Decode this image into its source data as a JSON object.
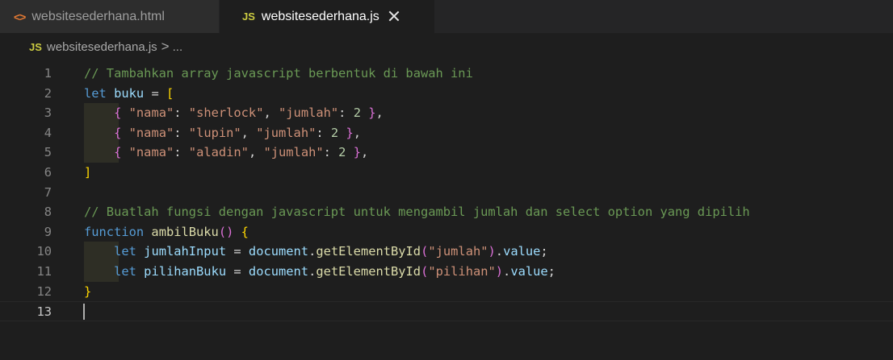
{
  "tabs": [
    {
      "label": "websitesederhana.html",
      "icon": "html-file-icon",
      "icon_glyph": "<>",
      "active": false
    },
    {
      "label": "websitesederhana.js",
      "icon": "js-file-icon",
      "icon_glyph": "JS",
      "active": true
    }
  ],
  "breadcrumb": {
    "icon_glyph": "JS",
    "file": "websitesederhana.js",
    "separator": ">",
    "rest": "..."
  },
  "editor": {
    "current_line": 13,
    "colors": {
      "background": "#1e1e1e",
      "comment": "#6a9955",
      "keyword": "#569cd6",
      "variable": "#9cdcfe",
      "string": "#ce9178",
      "number": "#b5cea8",
      "function": "#dcdcaa",
      "bracket_level1": "#ffd700",
      "bracket_level2": "#da70d6"
    },
    "lines": [
      {
        "n": "1",
        "indent": false,
        "tokens": [
          {
            "t": "// Tambahkan array javascript berbentuk di bawah ini",
            "c": "comment"
          }
        ]
      },
      {
        "n": "2",
        "indent": false,
        "tokens": [
          {
            "t": "let",
            "c": "kw"
          },
          {
            "t": " ",
            "c": "plain"
          },
          {
            "t": "buku",
            "c": "var"
          },
          {
            "t": " = ",
            "c": "plain"
          },
          {
            "t": "[",
            "c": "br1"
          }
        ]
      },
      {
        "n": "3",
        "indent": true,
        "tokens": [
          {
            "t": "    ",
            "c": "plain"
          },
          {
            "t": "{",
            "c": "br2"
          },
          {
            "t": " ",
            "c": "plain"
          },
          {
            "t": "\"nama\"",
            "c": "str"
          },
          {
            "t": ": ",
            "c": "plain"
          },
          {
            "t": "\"sherlock\"",
            "c": "str"
          },
          {
            "t": ", ",
            "c": "plain"
          },
          {
            "t": "\"jumlah\"",
            "c": "str"
          },
          {
            "t": ": ",
            "c": "plain"
          },
          {
            "t": "2",
            "c": "num"
          },
          {
            "t": " ",
            "c": "plain"
          },
          {
            "t": "}",
            "c": "br2"
          },
          {
            "t": ",",
            "c": "plain"
          }
        ]
      },
      {
        "n": "4",
        "indent": true,
        "tokens": [
          {
            "t": "    ",
            "c": "plain"
          },
          {
            "t": "{",
            "c": "br2"
          },
          {
            "t": " ",
            "c": "plain"
          },
          {
            "t": "\"nama\"",
            "c": "str"
          },
          {
            "t": ": ",
            "c": "plain"
          },
          {
            "t": "\"lupin\"",
            "c": "str"
          },
          {
            "t": ", ",
            "c": "plain"
          },
          {
            "t": "\"jumlah\"",
            "c": "str"
          },
          {
            "t": ": ",
            "c": "plain"
          },
          {
            "t": "2",
            "c": "num"
          },
          {
            "t": " ",
            "c": "plain"
          },
          {
            "t": "}",
            "c": "br2"
          },
          {
            "t": ",",
            "c": "plain"
          }
        ]
      },
      {
        "n": "5",
        "indent": true,
        "tokens": [
          {
            "t": "    ",
            "c": "plain"
          },
          {
            "t": "{",
            "c": "br2"
          },
          {
            "t": " ",
            "c": "plain"
          },
          {
            "t": "\"nama\"",
            "c": "str"
          },
          {
            "t": ": ",
            "c": "plain"
          },
          {
            "t": "\"aladin\"",
            "c": "str"
          },
          {
            "t": ", ",
            "c": "plain"
          },
          {
            "t": "\"jumlah\"",
            "c": "str"
          },
          {
            "t": ": ",
            "c": "plain"
          },
          {
            "t": "2",
            "c": "num"
          },
          {
            "t": " ",
            "c": "plain"
          },
          {
            "t": "}",
            "c": "br2"
          },
          {
            "t": ",",
            "c": "plain"
          }
        ]
      },
      {
        "n": "6",
        "indent": false,
        "tokens": [
          {
            "t": "]",
            "c": "br1"
          }
        ]
      },
      {
        "n": "7",
        "indent": false,
        "tokens": []
      },
      {
        "n": "8",
        "indent": false,
        "tokens": [
          {
            "t": "// Buatlah fungsi dengan javascript untuk mengambil jumlah dan select option yang dipilih",
            "c": "comment"
          }
        ]
      },
      {
        "n": "9",
        "indent": false,
        "tokens": [
          {
            "t": "function",
            "c": "kw"
          },
          {
            "t": " ",
            "c": "plain"
          },
          {
            "t": "ambilBuku",
            "c": "fn"
          },
          {
            "t": "()",
            "c": "br2"
          },
          {
            "t": " ",
            "c": "plain"
          },
          {
            "t": "{",
            "c": "br1"
          }
        ]
      },
      {
        "n": "10",
        "indent": true,
        "tokens": [
          {
            "t": "    ",
            "c": "plain"
          },
          {
            "t": "let",
            "c": "kw"
          },
          {
            "t": " ",
            "c": "plain"
          },
          {
            "t": "jumlahInput",
            "c": "var"
          },
          {
            "t": " = ",
            "c": "plain"
          },
          {
            "t": "document",
            "c": "var"
          },
          {
            "t": ".",
            "c": "plain"
          },
          {
            "t": "getElementById",
            "c": "fn"
          },
          {
            "t": "(",
            "c": "br2"
          },
          {
            "t": "\"jumlah\"",
            "c": "str"
          },
          {
            "t": ")",
            "c": "br2"
          },
          {
            "t": ".",
            "c": "plain"
          },
          {
            "t": "value",
            "c": "var"
          },
          {
            "t": ";",
            "c": "plain"
          }
        ]
      },
      {
        "n": "11",
        "indent": true,
        "tokens": [
          {
            "t": "    ",
            "c": "plain"
          },
          {
            "t": "let",
            "c": "kw"
          },
          {
            "t": " ",
            "c": "plain"
          },
          {
            "t": "pilihanBuku",
            "c": "var"
          },
          {
            "t": " = ",
            "c": "plain"
          },
          {
            "t": "document",
            "c": "var"
          },
          {
            "t": ".",
            "c": "plain"
          },
          {
            "t": "getElementById",
            "c": "fn"
          },
          {
            "t": "(",
            "c": "br2"
          },
          {
            "t": "\"pilihan\"",
            "c": "str"
          },
          {
            "t": ")",
            "c": "br2"
          },
          {
            "t": ".",
            "c": "plain"
          },
          {
            "t": "value",
            "c": "var"
          },
          {
            "t": ";",
            "c": "plain"
          }
        ]
      },
      {
        "n": "12",
        "indent": false,
        "tokens": [
          {
            "t": "}",
            "c": "br1"
          }
        ]
      },
      {
        "n": "13",
        "indent": false,
        "tokens": []
      }
    ]
  }
}
